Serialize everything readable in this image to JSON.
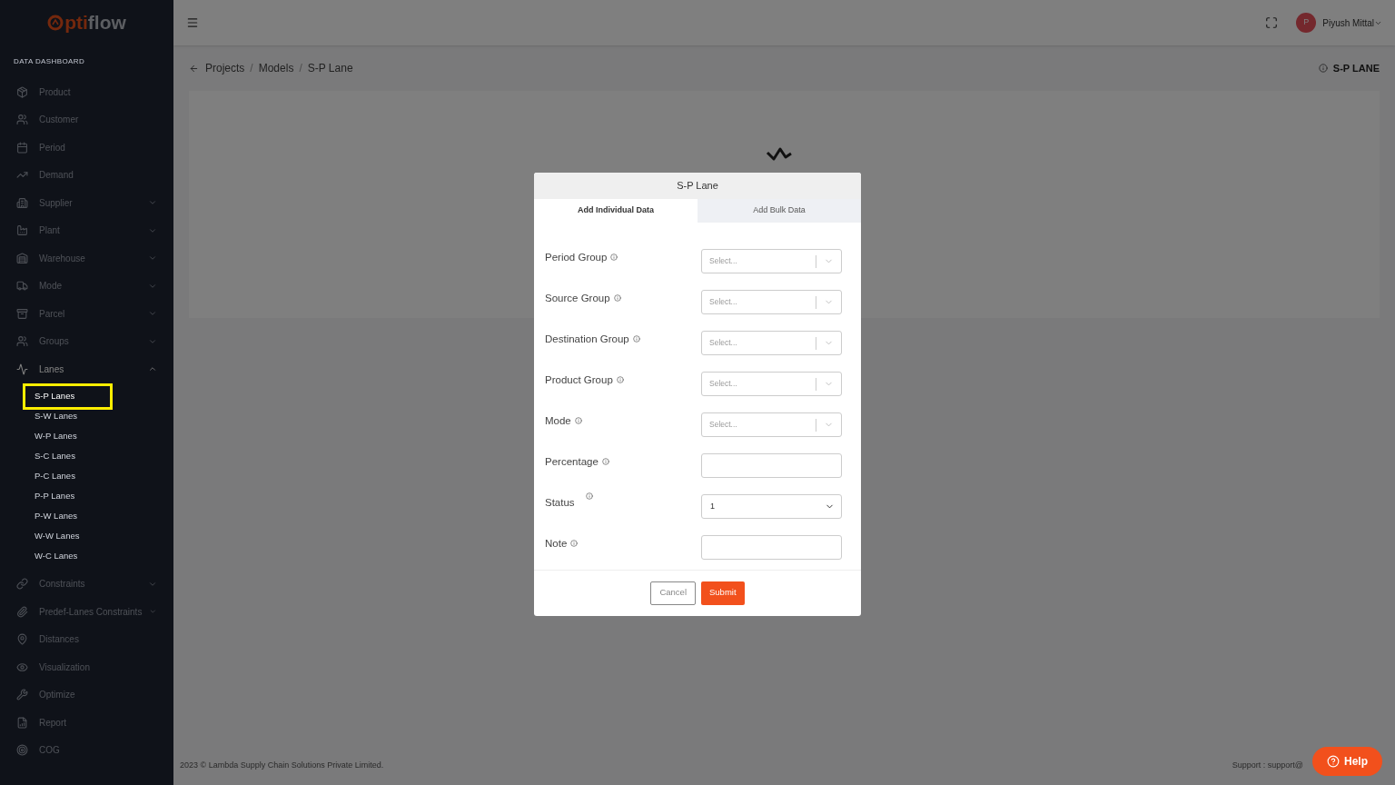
{
  "logo": {
    "accent": "pti",
    "rest": "flow"
  },
  "sidebar": {
    "section": "DATA DASHBOARD",
    "items": [
      {
        "label": "Product",
        "kind": "link"
      },
      {
        "label": "Customer",
        "kind": "link"
      },
      {
        "label": "Period",
        "kind": "link"
      },
      {
        "label": "Demand",
        "kind": "link"
      },
      {
        "label": "Supplier",
        "kind": "group",
        "expanded": false
      },
      {
        "label": "Plant",
        "kind": "group",
        "expanded": false
      },
      {
        "label": "Warehouse",
        "kind": "group",
        "expanded": false
      },
      {
        "label": "Mode",
        "kind": "group",
        "expanded": false
      },
      {
        "label": "Parcel",
        "kind": "group",
        "expanded": false
      },
      {
        "label": "Groups",
        "kind": "group",
        "expanded": false
      },
      {
        "label": "Lanes",
        "kind": "group",
        "expanded": true,
        "children": [
          {
            "label": "S-P Lanes",
            "selected": true
          },
          {
            "label": "S-W Lanes",
            "selected": false
          },
          {
            "label": "W-P Lanes",
            "selected": false
          },
          {
            "label": "S-C Lanes",
            "selected": false
          },
          {
            "label": "P-C Lanes",
            "selected": false
          },
          {
            "label": "P-P Lanes",
            "selected": false
          },
          {
            "label": "P-W Lanes",
            "selected": false
          },
          {
            "label": "W-W Lanes",
            "selected": false
          },
          {
            "label": "W-C Lanes",
            "selected": false
          }
        ]
      },
      {
        "label": "Constraints",
        "kind": "group",
        "expanded": false
      },
      {
        "label": "Predef-Lanes Constraints",
        "kind": "group",
        "expanded": false
      },
      {
        "label": "Distances",
        "kind": "link"
      },
      {
        "label": "Visualization",
        "kind": "link"
      },
      {
        "label": "Optimize",
        "kind": "link"
      },
      {
        "label": "Report",
        "kind": "link"
      },
      {
        "label": "COG",
        "kind": "link"
      }
    ]
  },
  "header": {
    "user": {
      "initial": "P",
      "name": "Piyush Mittal"
    }
  },
  "breadcrumb": [
    "Projects",
    "Models",
    "S-P Lane"
  ],
  "breadcrumb_separator": "/",
  "page_title": "S-P LANE",
  "modal": {
    "title": "S-P Lane",
    "tabs": [
      {
        "label": "Add Individual Data",
        "selected": true
      },
      {
        "label": "Add Bulk Data",
        "selected": false
      }
    ],
    "fields": [
      {
        "label": "Period Group",
        "kind": "select",
        "placeholder": "Select..."
      },
      {
        "label": "Source Group",
        "kind": "select",
        "placeholder": "Select..."
      },
      {
        "label": "Destination Group",
        "kind": "select",
        "placeholder": "Select..."
      },
      {
        "label": "Product Group",
        "kind": "select",
        "placeholder": "Select..."
      },
      {
        "label": "Mode",
        "kind": "select",
        "placeholder": "Select..."
      },
      {
        "label": "Percentage",
        "kind": "input"
      },
      {
        "label": "Status",
        "kind": "dropdown",
        "value": "1"
      },
      {
        "label": "Note",
        "kind": "input"
      }
    ],
    "buttons": [
      {
        "label": "Cancel",
        "kind": "secondary"
      },
      {
        "label": "Submit",
        "kind": "primary"
      }
    ]
  },
  "footer": {
    "copyright": "2023 © Lambda Supply Chain Solutions Private Limited.",
    "support": "Support : support@"
  },
  "help": "Help"
}
